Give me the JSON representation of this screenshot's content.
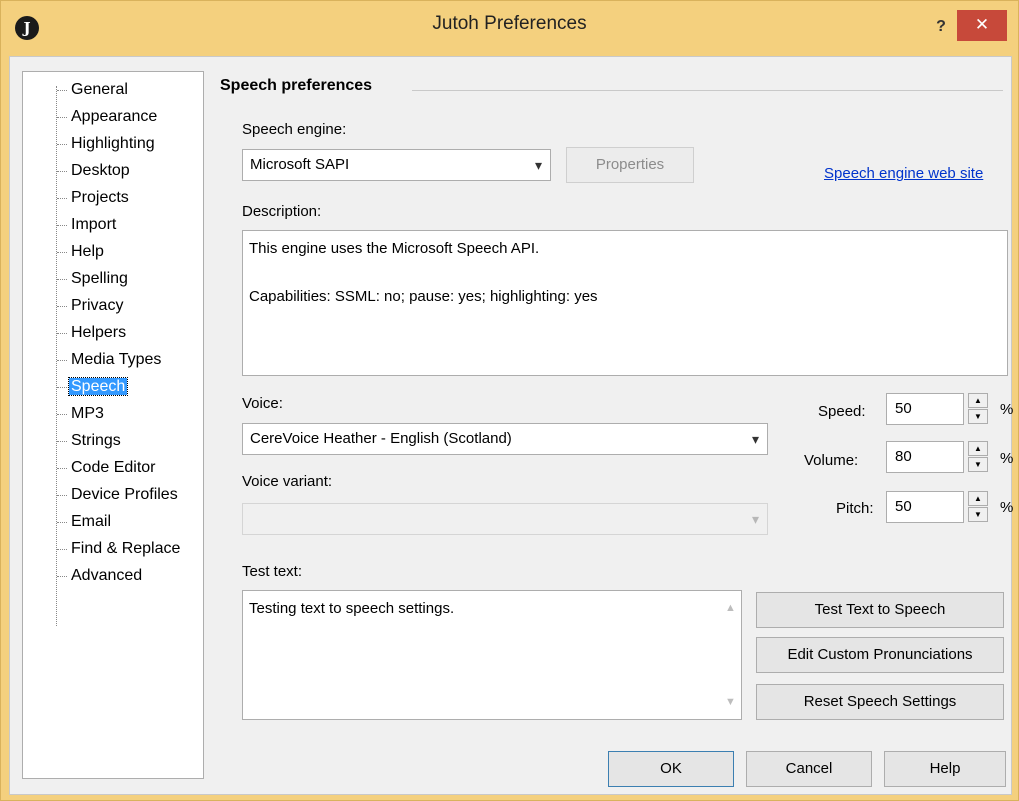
{
  "window": {
    "title": "Jutoh Preferences",
    "app_icon_glyph": "J",
    "help_glyph": "?",
    "close_glyph": "✕"
  },
  "tree": {
    "selected": "Speech",
    "items": [
      "General",
      "Appearance",
      "Highlighting",
      "Desktop",
      "Projects",
      "Import",
      "Help",
      "Spelling",
      "Privacy",
      "Helpers",
      "Media Types",
      "Speech",
      "MP3",
      "Strings",
      "Code Editor",
      "Device Profiles",
      "Email",
      "Find & Replace",
      "Advanced"
    ]
  },
  "speech": {
    "section_title": "Speech preferences",
    "engine_label": "Speech engine:",
    "engine_value": "Microsoft SAPI",
    "properties_label": "Properties",
    "engine_link": "Speech engine web site",
    "description_label": "Description:",
    "description_line1": "This engine uses the Microsoft Speech API.",
    "description_line2": "Capabilities: SSML: no; pause: yes; highlighting: yes",
    "voice_label": "Voice:",
    "voice_value": "CereVoice Heather - English (Scotland)",
    "voice_variant_label": "Voice variant:",
    "voice_variant_value": "",
    "speed_label": "Speed:",
    "speed_value": "50",
    "volume_label": "Volume:",
    "volume_value": "80",
    "pitch_label": "Pitch:",
    "pitch_value": "50",
    "percent": "%",
    "test_text_label": "Test text:",
    "test_text_value": "Testing text to speech settings.",
    "test_button": "Test Text to Speech",
    "edit_pron_button": "Edit Custom Pronunciations",
    "reset_button": "Reset Speech Settings"
  },
  "footer": {
    "ok": "OK",
    "cancel": "Cancel",
    "help": "Help"
  },
  "icons": {
    "dropdown_arrow": "▾",
    "spin_up": "▲",
    "spin_down": "▼",
    "scroll_up": "▲",
    "scroll_down": "▼"
  },
  "colors": {
    "titlebar": "#f4d07e",
    "close_button": "#c7493a",
    "selection": "#3399ff",
    "link": "#0033cc"
  }
}
